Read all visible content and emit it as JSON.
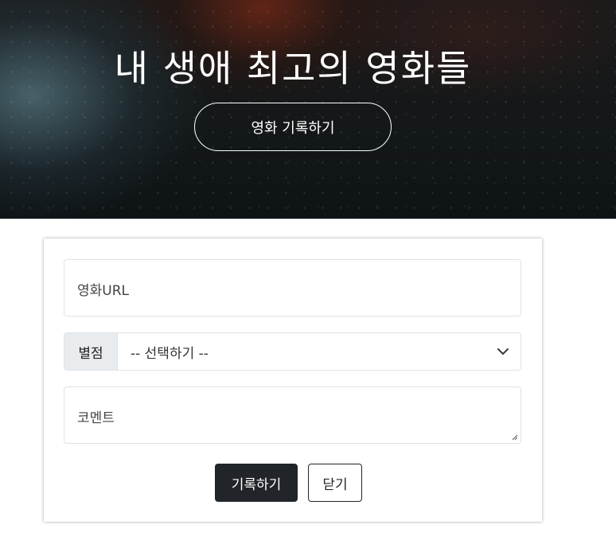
{
  "hero": {
    "title": "내 생애 최고의 영화들",
    "record_button_label": "영화 기록하기"
  },
  "form": {
    "url_placeholder": "영화URL",
    "rating_label": "별점",
    "rating_selected": "-- 선택하기 --",
    "comment_placeholder": "코멘트",
    "submit_label": "기록하기",
    "close_label": "닫기"
  },
  "icons": {
    "select_arrow": "chevron-down-icon",
    "textarea_resize": "resize-handle-icon"
  },
  "colors": {
    "dark_button": "#212529",
    "addon_background": "#e9ecef",
    "input_border": "#dee2e6"
  }
}
